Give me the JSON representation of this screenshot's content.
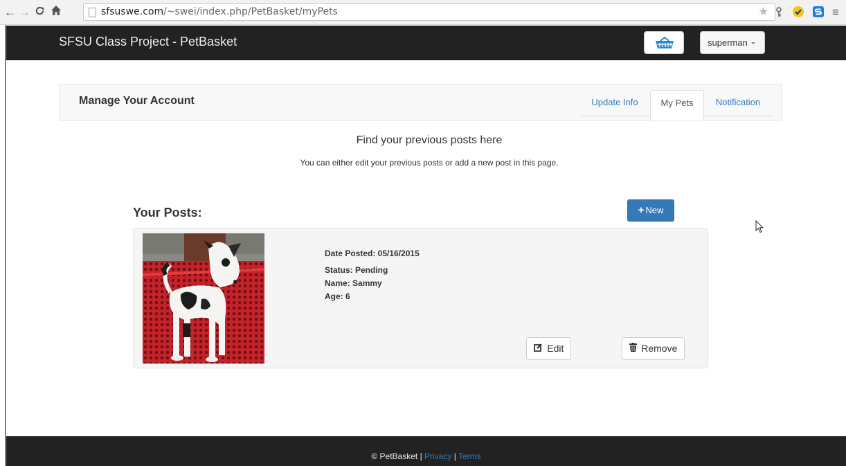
{
  "browser": {
    "url_host": "sfsuswe.com",
    "url_path": "/~swei/index.php/PetBasket/myPets"
  },
  "navbar": {
    "brand": "SFSU Class Project - PetBasket",
    "user_label": "superman"
  },
  "account": {
    "title": "Manage Your Account",
    "tabs": [
      "Update Info",
      "My Pets",
      "Notification"
    ],
    "active_tab": "My Pets"
  },
  "intro": {
    "heading": "Find your previous posts here",
    "subheading": "You can either edit your previous posts or add a new post in this page."
  },
  "posts": {
    "title": "Your Posts:",
    "new_label": "New",
    "items": [
      {
        "date_posted": "Date Posted: 05/16/2015",
        "status": "Status: Pending",
        "name": "Name: Sammy",
        "age": "Age: 6",
        "edit_label": "Edit",
        "remove_label": "Remove"
      }
    ]
  },
  "footer": {
    "copyright": "© PetBasket",
    "sep": "|",
    "privacy": "Privacy",
    "terms": "Terms"
  },
  "colors": {
    "navbar_bg": "#222222",
    "accent": "#337ab7"
  }
}
